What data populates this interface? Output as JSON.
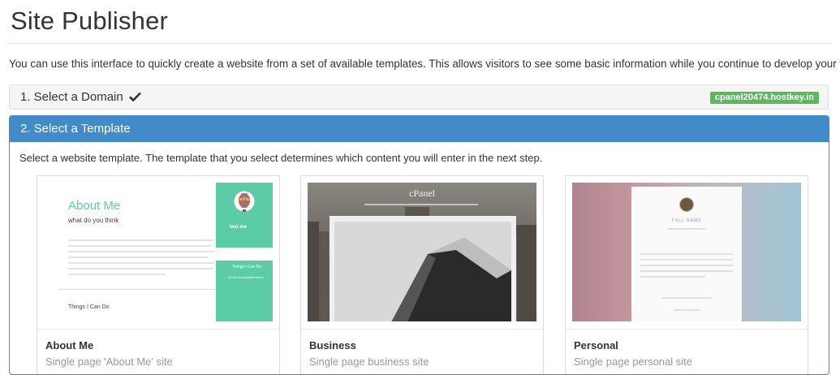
{
  "page": {
    "title": "Site Publisher",
    "intro": "You can use this interface to quickly create a website from a set of available templates. This allows visitors to see some basic information while you continue to develop your website."
  },
  "step1": {
    "label": "1. Select a Domain",
    "domain": "cpanel20474.hostkey.in",
    "check_icon": "check-icon"
  },
  "step2": {
    "label": "2. Select a Template",
    "instructions": "Select a website template. The template that you select determines which content you will enter in the next step."
  },
  "templates": [
    {
      "name": "About Me",
      "description": "Single page 'About Me' site",
      "thumb": {
        "heading": "About Me",
        "subheading": "what do you think",
        "section": "Things I Can Do",
        "side_name": "test me",
        "side_label": "Things I Can Do",
        "side_item": "A Few Accomplishments"
      }
    },
    {
      "name": "Business",
      "description": "Single page business site",
      "thumb": {
        "logo": "cPanel"
      }
    },
    {
      "name": "Personal",
      "description": "Single page personal site",
      "thumb": {
        "name": "FULL NAME"
      }
    }
  ],
  "colors": {
    "primary": "#428bca",
    "success": "#5cb85c",
    "accent": "#5ccca6"
  }
}
